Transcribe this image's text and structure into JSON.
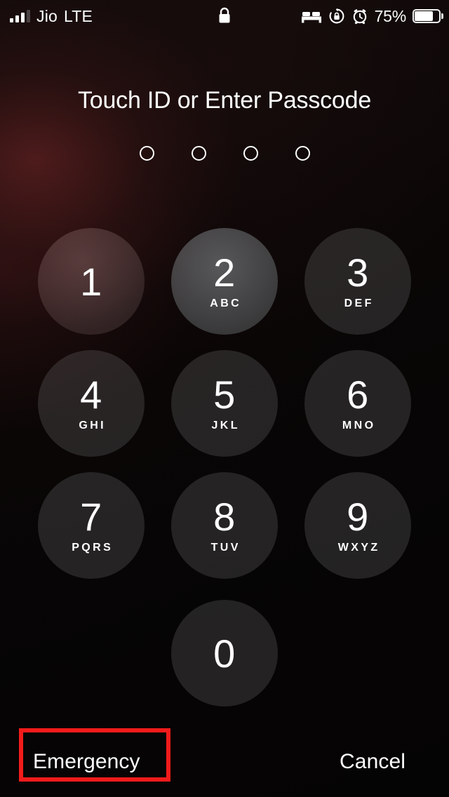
{
  "screen": {
    "name": "ios-lock-screen-passcode",
    "background_color": "#050404",
    "accent_highlight_color": "#f21b1b"
  },
  "status_bar": {
    "carrier": "Jio",
    "network_type": "LTE",
    "signal_bars_total": 4,
    "signal_bars_filled": 3,
    "battery_percent_label": "75%",
    "battery_level": 75,
    "icons": {
      "signal": "signal-bars-icon",
      "lock": "lock-icon",
      "bedtime": "bed-icon",
      "rotation_lock": "rotation-lock-icon",
      "alarm": "alarm-clock-icon",
      "battery": "battery-icon"
    }
  },
  "prompt": {
    "title": "Touch ID or Enter Passcode"
  },
  "passcode": {
    "length": 4,
    "entered": 0,
    "dots": [
      {
        "filled": false
      },
      {
        "filled": false
      },
      {
        "filled": false
      },
      {
        "filled": false
      }
    ]
  },
  "keypad": {
    "keys": [
      {
        "digit": "1",
        "letters": "",
        "state": "tinted"
      },
      {
        "digit": "2",
        "letters": "ABC",
        "state": "highlighted"
      },
      {
        "digit": "3",
        "letters": "DEF",
        "state": "normal"
      },
      {
        "digit": "4",
        "letters": "GHI",
        "state": "normal"
      },
      {
        "digit": "5",
        "letters": "JKL",
        "state": "normal"
      },
      {
        "digit": "6",
        "letters": "MNO",
        "state": "normal"
      },
      {
        "digit": "7",
        "letters": "PQRS",
        "state": "normal"
      },
      {
        "digit": "8",
        "letters": "TUV",
        "state": "normal"
      },
      {
        "digit": "9",
        "letters": "WXYZ",
        "state": "normal"
      }
    ],
    "zero_key": {
      "digit": "0",
      "letters": "",
      "state": "normal"
    }
  },
  "actions": {
    "emergency_label": "Emergency",
    "cancel_label": "Cancel"
  }
}
